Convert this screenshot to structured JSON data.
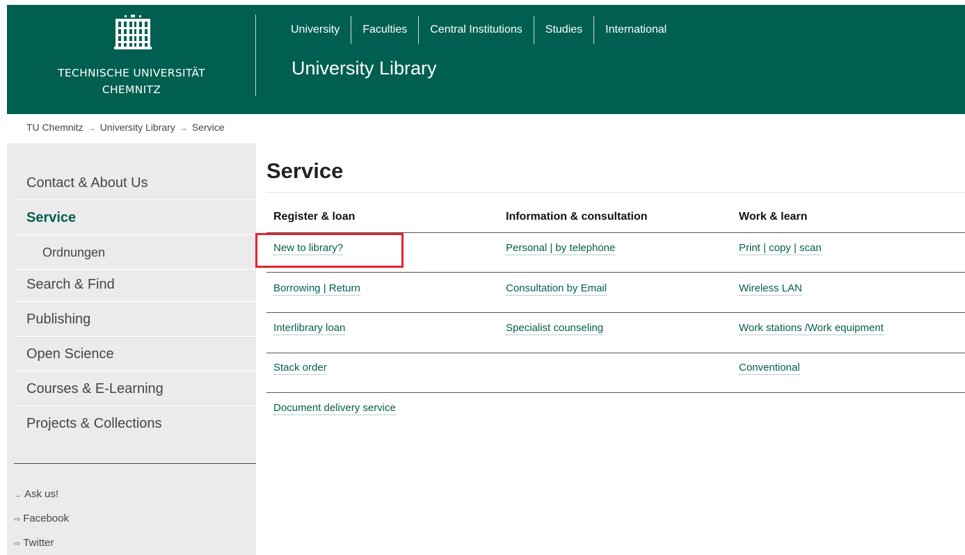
{
  "header": {
    "university_name_line1": "TECHNISCHE UNIVERSITÄT",
    "university_name_line2": "CHEMNITZ",
    "logo_icon": "building-icon",
    "nav": [
      "University",
      "Faculties",
      "Central Institutions",
      "Studies",
      "International"
    ],
    "site_title": "University Library",
    "background_color": "#005f50"
  },
  "breadcrumb": {
    "items": [
      "TU Chemnitz",
      "University Library",
      "Service"
    ],
    "separator": "→"
  },
  "sidebar": {
    "items": [
      {
        "label": "Contact & About Us"
      },
      {
        "label": "Service",
        "active": true
      },
      {
        "label": "Ordnungen",
        "sub": true
      },
      {
        "label": "Search & Find"
      },
      {
        "label": "Publishing"
      },
      {
        "label": "Open Science"
      },
      {
        "label": "Courses & E-Learning"
      },
      {
        "label": "Projects & Collections"
      }
    ],
    "links": [
      {
        "icon": "→",
        "label": "Ask us!"
      },
      {
        "icon": "⇨",
        "label": "Facebook"
      },
      {
        "icon": "⇨",
        "label": "Twitter"
      }
    ]
  },
  "main": {
    "title": "Service",
    "columns": [
      {
        "heading": "Register & loan",
        "links": [
          "New to library?",
          "Borrowing | Return",
          "Interlibrary loan",
          "Stack order",
          "Document delivery service"
        ]
      },
      {
        "heading": "Information & consultation",
        "links": [
          "Personal | by telephone",
          "Consultation by Email",
          "Specialist counseling"
        ]
      },
      {
        "heading": "Work & learn",
        "links": [
          "Print | copy | scan",
          "Wireless LAN",
          "Work stations /Work equipment",
          "Conventional"
        ]
      }
    ],
    "highlight_color": "#e5232b"
  }
}
